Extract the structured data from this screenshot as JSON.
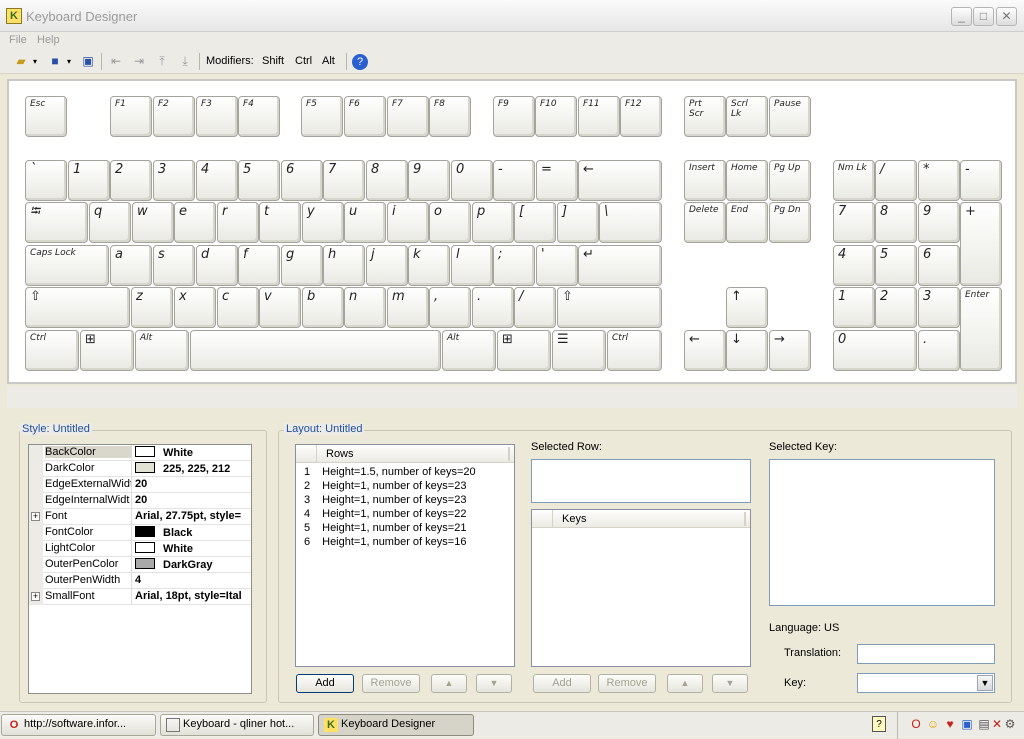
{
  "window": {
    "title": "Keyboard Designer",
    "minimize": "_",
    "maximize": "□",
    "close": "✕"
  },
  "menu": [
    "File",
    "Help"
  ],
  "toolbar": {
    "modifiers_label": "Modifiers:",
    "modifiers": [
      "Shift",
      "Ctrl",
      "Alt"
    ]
  },
  "keyboard": {
    "function_row": [
      "Esc",
      "F1",
      "F2",
      "F3",
      "F4",
      "F5",
      "F6",
      "F7",
      "F8",
      "F9",
      "F10",
      "F11",
      "F12",
      "Prt\nScr",
      "Scrl\nLk",
      "Pause"
    ],
    "number_row": [
      "`",
      "1",
      "2",
      "3",
      "4",
      "5",
      "6",
      "7",
      "8",
      "9",
      "0",
      "-",
      "=",
      "←"
    ],
    "qwerty_row": [
      "⭾",
      "q",
      "w",
      "e",
      "r",
      "t",
      "y",
      "u",
      "i",
      "o",
      "p",
      "[",
      "]",
      "\\"
    ],
    "home_row": [
      "Caps Lock",
      "a",
      "s",
      "d",
      "f",
      "g",
      "h",
      "j",
      "k",
      "l",
      ";",
      "'",
      "↵"
    ],
    "shift_row": [
      "⇧",
      "z",
      "x",
      "c",
      "v",
      "b",
      "n",
      "m",
      ",",
      ".",
      "/",
      "⇧"
    ],
    "bottom_row": [
      "Ctrl",
      "⊞",
      "Alt",
      "",
      "Alt",
      "⊞",
      "☰",
      "Ctrl"
    ],
    "nav_keys": [
      "Insert",
      "Home",
      "Pg Up",
      "Delete",
      "End",
      "Pg Dn"
    ],
    "arrow_keys": [
      "↑",
      "←",
      "↓",
      "→"
    ],
    "numpad": [
      "Nm Lk",
      "/",
      "*",
      "-",
      "7",
      "8",
      "9",
      "+",
      "4",
      "5",
      "6",
      "1",
      "2",
      "3",
      "Enter",
      "0",
      "."
    ]
  },
  "style_panel": {
    "title": "Style: Untitled",
    "properties": [
      {
        "name": "BackColor",
        "value": "White",
        "swatch": "#ffffff",
        "selected": true
      },
      {
        "name": "DarkColor",
        "value": "225, 225, 212",
        "swatch": "#e1e1d4"
      },
      {
        "name": "EdgeExternalWidt",
        "value": "20"
      },
      {
        "name": "EdgeInternalWidt",
        "value": "20"
      },
      {
        "name": "Font",
        "value": "Arial, 27.75pt, style=",
        "expandable": true
      },
      {
        "name": "FontColor",
        "value": "Black",
        "swatch": "#000000"
      },
      {
        "name": "LightColor",
        "value": "White",
        "swatch": "#ffffff"
      },
      {
        "name": "OuterPenColor",
        "value": "DarkGray",
        "swatch": "#a9a9a9"
      },
      {
        "name": "OuterPenWidth",
        "value": "4"
      },
      {
        "name": "SmallFont",
        "value": "Arial, 18pt, style=Ital",
        "expandable": true
      }
    ]
  },
  "layout_panel": {
    "title": "Layout: Untitled",
    "rows_header": "Rows",
    "rows": [
      {
        "num": "1",
        "text": "Height=1.5, number of keys=20"
      },
      {
        "num": "2",
        "text": "Height=1, number of keys=23"
      },
      {
        "num": "3",
        "text": "Height=1, number of keys=23"
      },
      {
        "num": "4",
        "text": "Height=1, number of keys=22"
      },
      {
        "num": "5",
        "text": "Height=1, number of keys=21"
      },
      {
        "num": "6",
        "text": "Height=1, number of keys=16"
      }
    ],
    "add": "Add",
    "remove": "Remove",
    "selected_row_label": "Selected Row:",
    "keys_header": "Keys",
    "selected_key_label": "Selected Key:",
    "language_label": "Language: US",
    "translation_label": "Translation:",
    "key_label": "Key:"
  },
  "taskbar": {
    "items": [
      {
        "label": "http://software.infor...",
        "icon": "opera-icon"
      },
      {
        "label": "Keyboard - qliner hot...",
        "icon": "window-icon"
      },
      {
        "label": "Keyboard Designer",
        "icon": "app-icon",
        "active": true
      }
    ]
  }
}
